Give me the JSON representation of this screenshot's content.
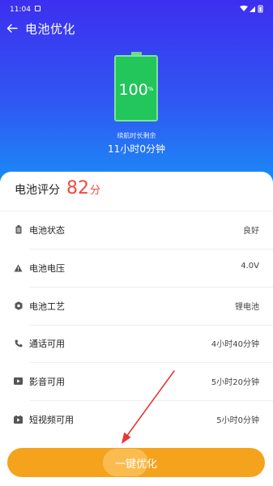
{
  "status_bar": {
    "time": "11:04"
  },
  "header": {
    "title": "电池优化"
  },
  "battery": {
    "level_percent": 100,
    "value": "100",
    "unit": "%"
  },
  "remaining": {
    "label": "续航时长剩余",
    "value": "11小时0分钟"
  },
  "score": {
    "label": "电池评分",
    "value": "82",
    "unit": "分"
  },
  "rows": [
    {
      "icon": "battery-icon",
      "label": "电池状态",
      "value": "良好"
    },
    {
      "icon": "triangle-warning-icon",
      "label": "电池电压",
      "value": "4.0V"
    },
    {
      "icon": "gear-icon",
      "label": "电池工艺",
      "value": "锂电池"
    },
    {
      "icon": "phone-icon",
      "label": "通话可用",
      "value": "4小时40分钟"
    },
    {
      "icon": "video-play-icon",
      "label": "影音可用",
      "value": "5小时20分钟"
    },
    {
      "icon": "short-video-icon",
      "label": "短视频可用",
      "value": "5小时0分钟"
    }
  ],
  "action": {
    "label": "一键优化"
  },
  "colors": {
    "hero_top": "#3d2ff0",
    "hero_bottom": "#1a8ef6",
    "battery_green": "#2ccf63",
    "score_red": "#f04a3e",
    "button_orange": "#f5a21d",
    "annotation_arrow": "#e53935"
  }
}
